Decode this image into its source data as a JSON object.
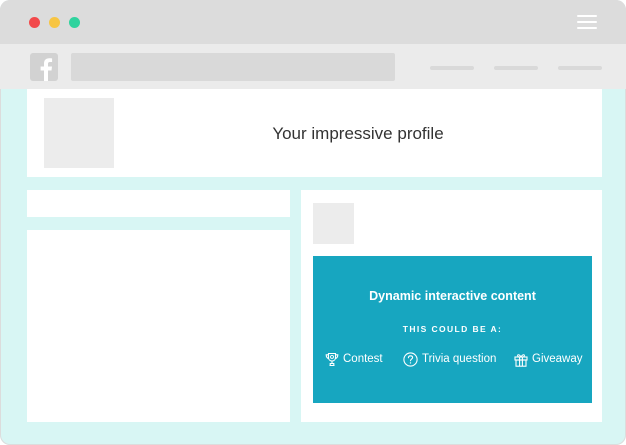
{
  "window": {
    "controls": [
      "close",
      "minimize",
      "maximize"
    ],
    "menu_icon": "hamburger-menu-icon"
  },
  "navbar": {
    "logo_icon": "facebook-logo-icon"
  },
  "profile": {
    "title": "Your impressive profile"
  },
  "cta": {
    "title": "Dynamic interactive content",
    "subtitle": "THIS COULD BE A:",
    "options": [
      {
        "label": "Contest",
        "icon": "trophy-icon"
      },
      {
        "label": "Trivia question",
        "icon": "question-circle-icon"
      },
      {
        "label": "Giveaway",
        "icon": "gift-icon"
      }
    ]
  },
  "colors": {
    "background": "#d8f6f4",
    "titlebar": "#dcdcdc",
    "accent": "#17a6c0",
    "close": "#f2494b",
    "minimize": "#f7c543",
    "maximize": "#2fd39e"
  }
}
